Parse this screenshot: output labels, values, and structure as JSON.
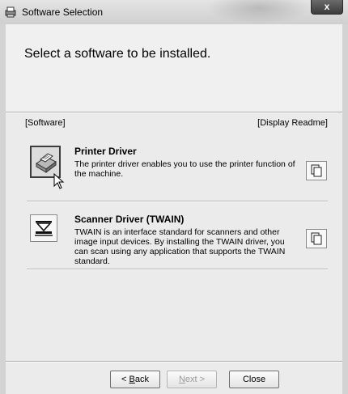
{
  "window": {
    "title": "Software Selection",
    "close_label": "x"
  },
  "header": {
    "title": "Select a software to be installed."
  },
  "columns": {
    "software": "[Software]",
    "readme": "[Display Readme]"
  },
  "items": [
    {
      "title": "Printer Driver",
      "description": "The printer driver enables you to use the printer function of the machine.",
      "icon": "printer-icon",
      "state": "pressed"
    },
    {
      "title": "Scanner Driver (TWAIN)",
      "description": "TWAIN is an interface standard for scanners and other image input devices. By installing the TWAIN driver, you can scan using any application that supports the TWAIN standard.",
      "icon": "scanner-icon",
      "state": "normal"
    }
  ],
  "footer": {
    "back_prefix": "< ",
    "back_key": "B",
    "back_rest": "ack",
    "next_key": "N",
    "next_rest": "ext >",
    "close_label": "Close",
    "next_disabled": true
  }
}
